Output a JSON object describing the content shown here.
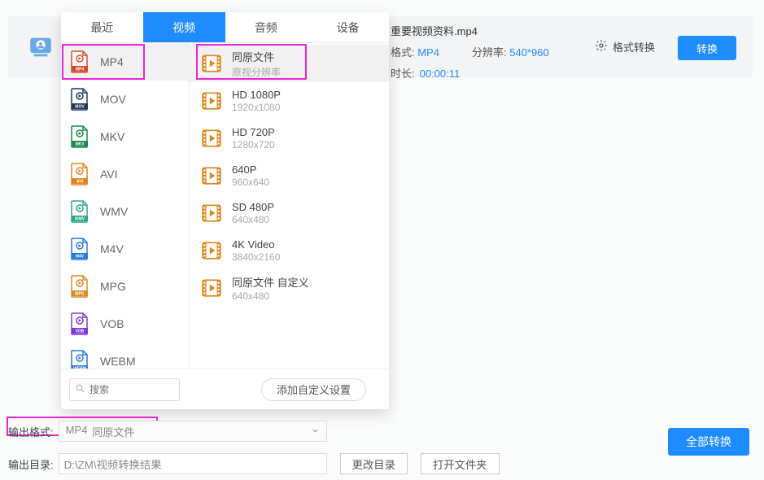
{
  "file": {
    "name": "重要视频资料.mp4",
    "format_label": "格式:",
    "format_value": "MP4",
    "resolution_label": "分辨率:",
    "resolution_value": "540*960",
    "duration_label": "时长:",
    "duration_value": "00:00:11",
    "format_convert_label": "格式转换",
    "convert_button": "转换"
  },
  "tabs": {
    "recent": "最近",
    "video": "视频",
    "audio": "音频",
    "device": "设备"
  },
  "formats": [
    "MP4",
    "MOV",
    "MKV",
    "AVI",
    "WMV",
    "M4V",
    "MPG",
    "VOB",
    "WEBM"
  ],
  "format_colors": [
    "#d84c2a",
    "#1f3a5f",
    "#1a8a4a",
    "#e0851e",
    "#2ba889",
    "#2a7bd6",
    "#d88a25",
    "#7e3ad6",
    "#2a7bd6"
  ],
  "resolutions": [
    {
      "main": "同原文件",
      "sub": "原视分辨率"
    },
    {
      "main": "HD 1080P",
      "sub": "1920x1080"
    },
    {
      "main": "HD 720P",
      "sub": "1280x720"
    },
    {
      "main": "640P",
      "sub": "960x640"
    },
    {
      "main": "SD 480P",
      "sub": "640x480"
    },
    {
      "main": "4K Video",
      "sub": "3840x2160"
    },
    {
      "main": "同原文件 自定义",
      "sub": "640x480"
    }
  ],
  "panel_foot": {
    "search_placeholder": "搜索",
    "custom_button": "添加自定义设置"
  },
  "bottom": {
    "output_format_label": "输出格式:",
    "output_format_value": "MP4",
    "output_format_value2": "同原文件",
    "output_dir_label": "输出目录:",
    "output_dir_value": "D:\\ZM\\视频转换结果",
    "change_dir": "更改目录",
    "open_folder": "打开文件夹",
    "convert_all": "全部转换"
  }
}
